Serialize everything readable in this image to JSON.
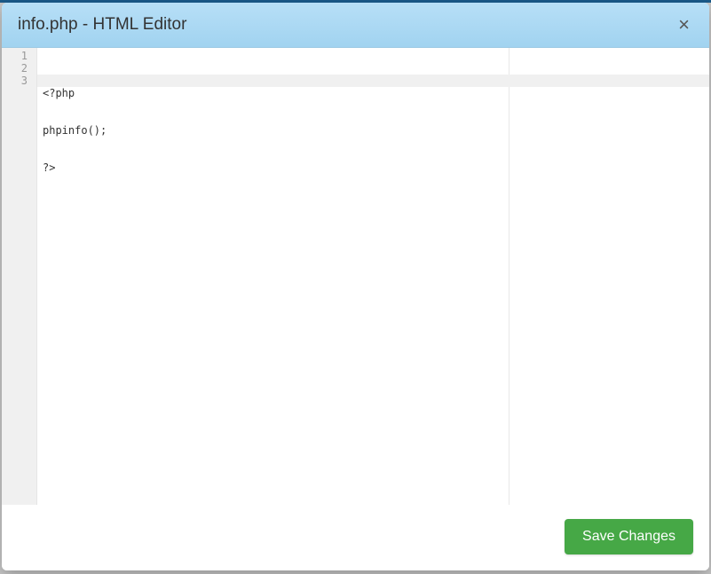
{
  "modal": {
    "title": "info.php - HTML Editor",
    "close_label": "×",
    "save_label": "Save Changes"
  },
  "editor": {
    "lines": [
      {
        "num": "1",
        "text": "<?php"
      },
      {
        "num": "2",
        "text": "phpinfo();"
      },
      {
        "num": "3",
        "text": "?>"
      }
    ],
    "active_line_index": 2
  }
}
